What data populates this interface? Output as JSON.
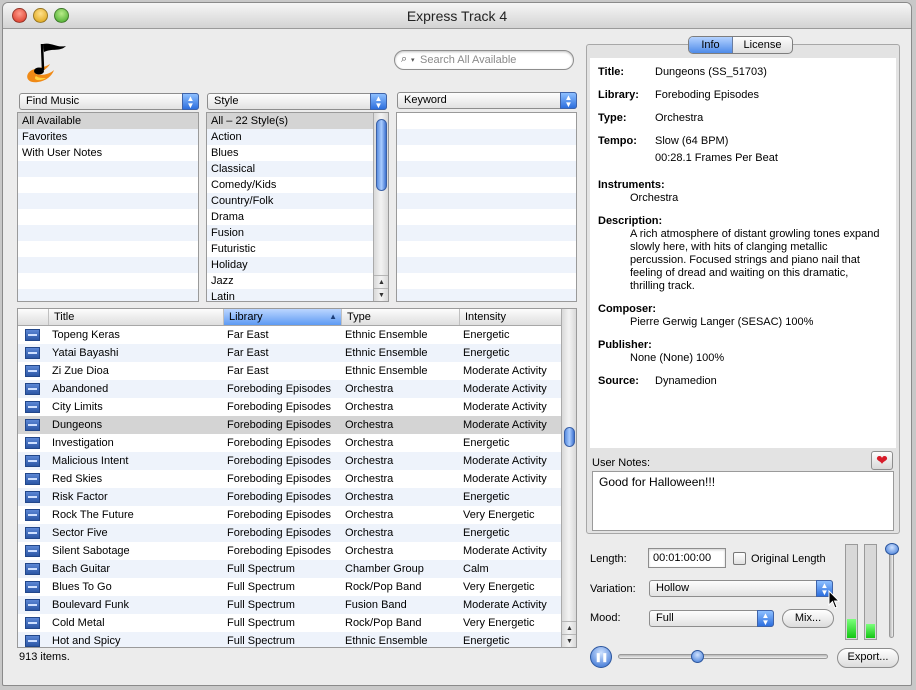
{
  "window": {
    "title": "Express Track 4"
  },
  "search": {
    "placeholder": "Search All Available"
  },
  "filters": {
    "find_music": {
      "label": "Find Music",
      "items": [
        "All Available",
        "Favorites",
        "With User Notes"
      ],
      "selected_index": 0
    },
    "style": {
      "label": "Style",
      "items": [
        "All – 22 Style(s)",
        "Action",
        "Blues",
        "Classical",
        "Comedy/Kids",
        "Country/Folk",
        "Drama",
        "Fusion",
        "Futuristic",
        "Holiday",
        "Jazz",
        "Latin"
      ],
      "selected_index": 0
    },
    "keyword": {
      "label": "Keyword",
      "items": []
    }
  },
  "table": {
    "columns": [
      "Title",
      "Library",
      "Type",
      "Intensity"
    ],
    "sorted_column": "Library",
    "selected_index": 5,
    "rows": [
      [
        "Topeng Keras",
        "Far East",
        "Ethnic Ensemble",
        "Energetic"
      ],
      [
        "Yatai Bayashi",
        "Far East",
        "Ethnic Ensemble",
        "Energetic"
      ],
      [
        "Zi Zue Dioa",
        "Far East",
        "Ethnic Ensemble",
        "Moderate Activity"
      ],
      [
        "Abandoned",
        "Foreboding Episodes",
        "Orchestra",
        "Moderate Activity"
      ],
      [
        "City Limits",
        "Foreboding Episodes",
        "Orchestra",
        "Moderate Activity"
      ],
      [
        "Dungeons",
        "Foreboding Episodes",
        "Orchestra",
        "Moderate Activity"
      ],
      [
        "Investigation",
        "Foreboding Episodes",
        "Orchestra",
        "Energetic"
      ],
      [
        "Malicious Intent",
        "Foreboding Episodes",
        "Orchestra",
        "Moderate Activity"
      ],
      [
        "Red Skies",
        "Foreboding Episodes",
        "Orchestra",
        "Moderate Activity"
      ],
      [
        "Risk Factor",
        "Foreboding Episodes",
        "Orchestra",
        "Energetic"
      ],
      [
        "Rock The Future",
        "Foreboding Episodes",
        "Orchestra",
        "Very Energetic"
      ],
      [
        "Sector Five",
        "Foreboding Episodes",
        "Orchestra",
        "Energetic"
      ],
      [
        "Silent Sabotage",
        "Foreboding Episodes",
        "Orchestra",
        "Moderate Activity"
      ],
      [
        "Bach Guitar",
        "Full Spectrum",
        "Chamber Group",
        "Calm"
      ],
      [
        "Blues To Go",
        "Full Spectrum",
        "Rock/Pop Band",
        "Very Energetic"
      ],
      [
        "Boulevard Funk",
        "Full Spectrum",
        "Fusion Band",
        "Moderate Activity"
      ],
      [
        "Cold Metal",
        "Full Spectrum",
        "Rock/Pop Band",
        "Very Energetic"
      ],
      [
        "Hot and Spicy",
        "Full Spectrum",
        "Ethnic Ensemble",
        "Energetic"
      ]
    ]
  },
  "status": {
    "count_text": "913 items."
  },
  "info_panel": {
    "tabs": [
      "Info",
      "License"
    ],
    "active_tab": "Info",
    "labels": {
      "title": "Title:",
      "library": "Library:",
      "type": "Type:",
      "tempo": "Tempo:",
      "instruments": "Instruments:",
      "description": "Description:",
      "composer": "Composer:",
      "publisher": "Publisher:",
      "source": "Source:"
    },
    "title": "Dungeons (SS_51703)",
    "library": "Foreboding Episodes",
    "type": "Orchestra",
    "tempo": "Slow (64 BPM)",
    "frames": "00:28.1 Frames Per Beat",
    "instruments": "Orchestra",
    "description": "A rich atmosphere of distant growling tones expand slowly here, with hits of clanging metallic percussion. Focused strings and piano nail that feeling of dread and waiting on this dramatic, thrilling track.",
    "composer": "Pierre Gerwig Langer (SESAC) 100%",
    "publisher": "None (None) 100%",
    "source": "Dynamedion"
  },
  "notes": {
    "label": "User Notes:",
    "text": "Good for Halloween!!!"
  },
  "controls": {
    "length_label": "Length:",
    "length_value": "00:01:00:00",
    "original_length_label": "Original Length",
    "original_length_checked": false,
    "variation_label": "Variation:",
    "variation_value": "Hollow",
    "mood_label": "Mood:",
    "mood_value": "Full",
    "mix_button": "Mix...",
    "export_button": "Export...",
    "level_meters": [
      0.2,
      0.15
    ],
    "volume_level": 1.0,
    "playback_position": 0.37
  },
  "colors": {
    "accent": "#4e8be9",
    "meter": "#14c614",
    "heart": "#d81c2a"
  }
}
